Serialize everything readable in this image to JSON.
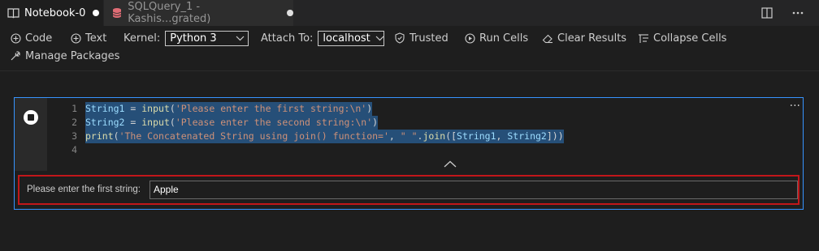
{
  "tabs": [
    {
      "label": "Notebook-0",
      "icon": "book-icon",
      "active": true,
      "dirty": true
    },
    {
      "label": "SQLQuery_1 - Kashis...grated)",
      "icon": "database-icon",
      "active": false,
      "dirty": true
    }
  ],
  "tabbar_actions": [
    "split-editor-icon",
    "more-actions-icon"
  ],
  "toolbar": {
    "code_label": "Code",
    "text_label": "Text",
    "kernel_label": "Kernel:",
    "kernel_value": "Python 3",
    "attach_label": "Attach To:",
    "attach_value": "localhost",
    "trusted_label": "Trusted",
    "run_cells_label": "Run Cells",
    "clear_results_label": "Clear Results",
    "collapse_cells_label": "Collapse Cells",
    "manage_packages_label": "Manage Packages"
  },
  "cell": {
    "lines": [
      {
        "num": "1",
        "tokens": [
          [
            "var",
            "String1"
          ],
          [
            "op",
            " = "
          ],
          [
            "fn",
            "input"
          ],
          [
            "op",
            "("
          ],
          [
            "str",
            "'Please enter the first string:\\n'"
          ],
          [
            "op",
            ")"
          ]
        ]
      },
      {
        "num": "2",
        "tokens": [
          [
            "var",
            "String2"
          ],
          [
            "op",
            " = "
          ],
          [
            "fn",
            "input"
          ],
          [
            "op",
            "("
          ],
          [
            "str",
            "'Please enter the second string:\\n'"
          ],
          [
            "op",
            ")"
          ]
        ]
      },
      {
        "num": "3",
        "tokens": [
          [
            "fn",
            "print"
          ],
          [
            "op",
            "("
          ],
          [
            "str",
            "'The Concatenated String using join() function='"
          ],
          [
            "op",
            ", "
          ],
          [
            "str",
            "\" \""
          ],
          [
            "op",
            "."
          ],
          [
            "fn",
            "join"
          ],
          [
            "op",
            "(["
          ],
          [
            "var",
            "String1"
          ],
          [
            "op",
            ", "
          ],
          [
            "var",
            "String2"
          ],
          [
            "op",
            "]))"
          ]
        ]
      },
      {
        "num": "4",
        "tokens": []
      }
    ],
    "more_label": "···"
  },
  "output": {
    "prompt_label": "Please enter the first string:",
    "input_value": "Apple"
  },
  "colors": {
    "accent": "#3794ff",
    "prompt_border": "#c2171a",
    "selection": "#264f78"
  }
}
